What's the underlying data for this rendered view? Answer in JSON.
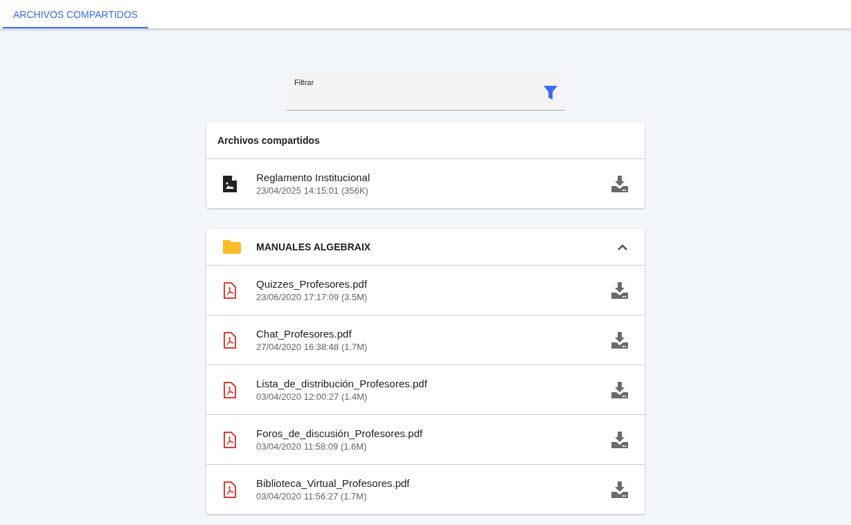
{
  "tabs": [
    {
      "label": "ARCHIVOS COMPARTIDOS",
      "selected": true
    }
  ],
  "filter": {
    "placeholder": "Filtrar"
  },
  "shared": {
    "title": "Archivos compartidos",
    "files": [
      {
        "kind": "image",
        "name": "Reglamento Institucional",
        "meta": "23/04/2025 14:15:01 (356K)"
      }
    ]
  },
  "folder": {
    "title": "MANUALES ALGEBRAIX",
    "expanded": true,
    "files": [
      {
        "kind": "pdf",
        "name": "Quizzes_Profesores.pdf",
        "meta": "23/06/2020 17:17:09 (3.5M)"
      },
      {
        "kind": "pdf",
        "name": "Chat_Profesores.pdf",
        "meta": "27/04/2020 16:38:48 (1.7M)"
      },
      {
        "kind": "pdf",
        "name": "Lista_de_distribución_Profesores.pdf",
        "meta": "03/04/2020 12:00:27 (1.4M)"
      },
      {
        "kind": "pdf",
        "name": "Foros_de_discusión_Profesores.pdf",
        "meta": "03/04/2020 11:58:09 (1.6M)"
      },
      {
        "kind": "pdf",
        "name": "Biblioteca_Virtual_Profesores.pdf",
        "meta": "03/04/2020 11:56:27 (1.7M)"
      }
    ]
  }
}
